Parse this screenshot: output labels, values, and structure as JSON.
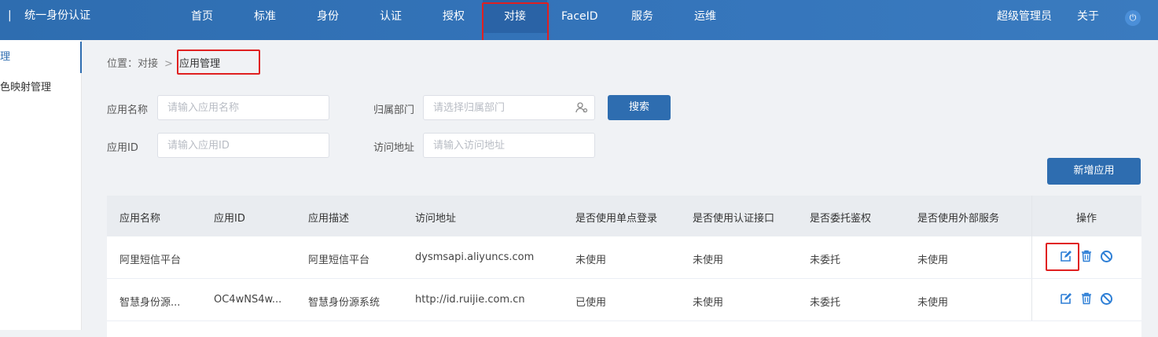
{
  "app": {
    "separator": "|",
    "title": "统一身份认证"
  },
  "nav": {
    "items": [
      {
        "label": "首页"
      },
      {
        "label": "标准"
      },
      {
        "label": "身份"
      },
      {
        "label": "认证"
      },
      {
        "label": "授权"
      },
      {
        "label": "对接"
      },
      {
        "label": "FaceID"
      },
      {
        "label": "服务"
      },
      {
        "label": "运维"
      }
    ],
    "active": "对接",
    "user": "超级管理员",
    "about": "关于"
  },
  "sidebar": {
    "items": [
      {
        "label": "理"
      },
      {
        "label": "色映射管理"
      }
    ]
  },
  "breadcrumb": {
    "prefix": "位置：",
    "parent": "对接",
    "arrow": ">",
    "current": "应用管理"
  },
  "filters": {
    "app_name": {
      "label": "应用名称",
      "placeholder": "请输入应用名称"
    },
    "dept": {
      "label": "归属部门",
      "placeholder": "请选择归属部门"
    },
    "app_id": {
      "label": "应用ID",
      "placeholder": "请输入应用ID"
    },
    "url": {
      "label": "访问地址",
      "placeholder": "请输入访问地址"
    },
    "search_label": "搜索",
    "add_label": "新增应用"
  },
  "table": {
    "columns": [
      "应用名称",
      "应用ID",
      "应用描述",
      "访问地址",
      "是否使用单点登录",
      "是否使用认证接口",
      "是否委托鉴权",
      "是否使用外部服务",
      "操作"
    ],
    "rows": [
      [
        "阿里短信平台",
        "",
        "阿里短信平台",
        "dysmsapi.aliyuncs.com",
        "未使用",
        "未使用",
        "未委托",
        "未使用"
      ],
      [
        "智慧身份源...",
        "OC4wNS4w...",
        "智慧身份源系统",
        "http://id.ruijie.com.cn",
        "已使用",
        "未使用",
        "未委托",
        "未使用"
      ]
    ]
  },
  "icons": {
    "edit": "edit-icon",
    "delete": "trash-icon",
    "disable": "ban-icon",
    "dept": "users-icon",
    "logout": "logout-icon"
  },
  "colors": {
    "primary": "#2e6db0",
    "highlight": "#e02020",
    "action_icon": "#2e7fd6"
  }
}
